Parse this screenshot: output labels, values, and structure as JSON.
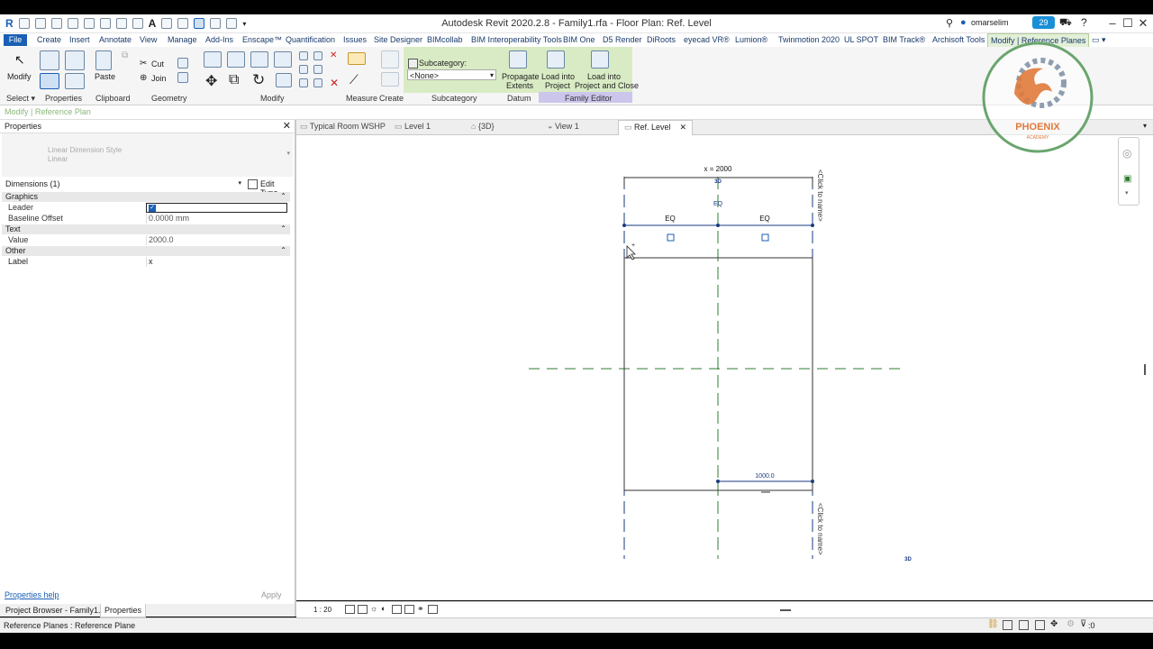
{
  "app": {
    "title": "Autodesk Revit 2020.2.8 - Family1.rfa - Floor Plan: Ref. Level",
    "user": "omarselim",
    "notification_count": "29"
  },
  "ribbon_tabs": [
    "File",
    "Create",
    "Insert",
    "Annotate",
    "View",
    "Manage",
    "Add-Ins",
    "Enscape™",
    "Quantification",
    "Issues",
    "Site Designer",
    "BIMcollab",
    "BIM Interoperability Tools",
    "BIM One",
    "D5 Render",
    "DiRoots",
    "eyecad VR®",
    "Lumion®",
    "Twinmotion 2020",
    "UL SPOT",
    "BIM Track®",
    "Archisoft Tools",
    "Modify | Reference Planes"
  ],
  "ribbon": {
    "modify": "Modify",
    "paste": "Paste",
    "cut": "Cut",
    "join": "Join",
    "subcategory_label": "Subcategory:",
    "subcategory_value": "<None>",
    "propagate": [
      "Propagate",
      "Extents"
    ],
    "load_project": [
      "Load into",
      "Project"
    ],
    "load_close": [
      "Load into",
      "Project and Close"
    ],
    "panels": [
      "Select ▾",
      "Properties",
      "Clipboard",
      "Geometry",
      "Modify",
      "Measure",
      "Create",
      "Subcategory",
      "Datum",
      "Family Editor"
    ]
  },
  "context_bar": "Modify | Reference Plan",
  "properties": {
    "title": "Properties",
    "type_name": "Linear Dimension Style",
    "type_sub": "Linear",
    "selector": "Dimensions (1)",
    "edit_type": "Edit Type",
    "categories": {
      "graphics": "Graphics",
      "text": "Text",
      "other": "Other"
    },
    "rows": {
      "leader": "Leader",
      "baseline_offset": "Baseline Offset",
      "baseline_offset_value": "0.0000 mm",
      "value": "Value",
      "value_value": "2000.0",
      "label": "Label",
      "label_value": "x"
    },
    "help": "Properties help",
    "apply": "Apply"
  },
  "bottom_tabs": [
    "Project Browser - Family1.rfa",
    "Properties"
  ],
  "view_tabs": [
    "Typical Room WSHP",
    "Level 1",
    "{3D}",
    "View 1",
    "Ref. Level"
  ],
  "canvas": {
    "top_dim": "x = 2000",
    "eq": "EQ",
    "bottom_dim": "1000.0",
    "click_to_name": "<Click to name>",
    "marker": "3D"
  },
  "view_scale": "1 : 20",
  "status": "Reference Planes : Reference Plane",
  "status_filter": ":0",
  "logo": {
    "name": "PHOENIX",
    "sub": "ACADEMY"
  },
  "colors": {
    "accent": "#1a5fb4",
    "ref_plane": "#2e7d32",
    "dim": "#1a3a80",
    "logo": "#e07a3c"
  }
}
